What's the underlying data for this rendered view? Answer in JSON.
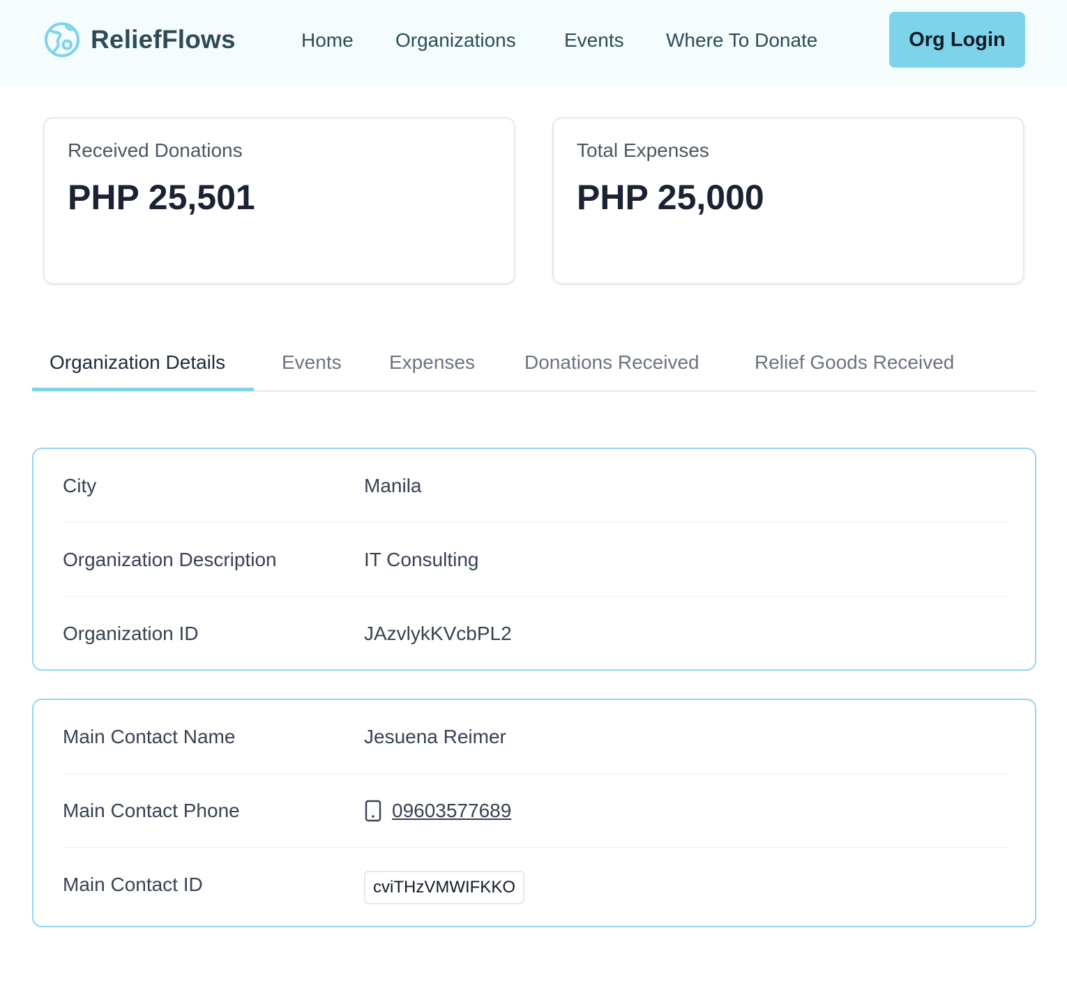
{
  "header": {
    "brand_name": "ReliefFlows",
    "brand_icon": "globe-icon",
    "nav": [
      {
        "label": "Home"
      },
      {
        "label": "Organizations"
      },
      {
        "label": "Events"
      },
      {
        "label": "Where To Donate"
      }
    ],
    "login_label": "Org Login",
    "accent_color": "#7dd3ea"
  },
  "stats": {
    "received": {
      "label": "Received Donations",
      "value": "PHP 25,501"
    },
    "expenses": {
      "label": "Total Expenses",
      "value": "PHP 25,000"
    }
  },
  "tabs": [
    {
      "label": "Organization Details",
      "active": true
    },
    {
      "label": "Events",
      "active": false
    },
    {
      "label": "Expenses",
      "active": false
    },
    {
      "label": "Donations Received",
      "active": false
    },
    {
      "label": "Relief Goods Received",
      "active": false
    }
  ],
  "organization": {
    "rows": [
      {
        "label": "City",
        "value": "Manila"
      },
      {
        "label": "Organization Description",
        "value": "IT Consulting"
      },
      {
        "label": "Organization ID",
        "value": "JAzvlykKVcbPL2"
      }
    ]
  },
  "contact": {
    "name_label": "Main Contact Name",
    "name_value": "Jesuena Reimer",
    "phone_label": "Main Contact Phone",
    "phone_icon": "phone-icon",
    "phone_value": "09603577689",
    "id_label": "Main Contact ID",
    "id_value": "cviTHzVMWIFKKO"
  }
}
